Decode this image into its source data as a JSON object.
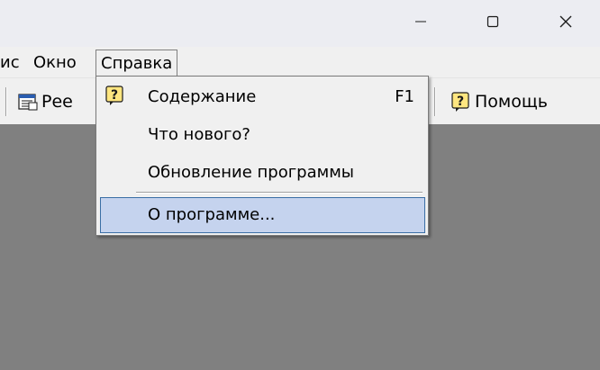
{
  "window": {
    "buttons": {
      "minimize_icon": "minimize-icon",
      "maximize_icon": "maximize-icon",
      "close_icon": "close-icon"
    }
  },
  "menubar": {
    "items": [
      {
        "label": "ис",
        "open": false
      },
      {
        "label": "Окно",
        "open": false
      },
      {
        "label": "Справка",
        "open": true
      }
    ]
  },
  "toolbar": {
    "registry_label": "Рее",
    "help_label": "Помощь"
  },
  "help_menu": {
    "items": [
      {
        "label": "Содержание",
        "shortcut": "F1"
      },
      {
        "label": "Что нового?",
        "shortcut": ""
      },
      {
        "label": "Обновление программы",
        "shortcut": ""
      },
      {
        "label": "О программе...",
        "shortcut": ""
      }
    ],
    "selected_index": 3
  },
  "colors": {
    "workspace": "#808080",
    "selection_fill": "#c5d3ee",
    "selection_border": "#3a6ea5",
    "help_icon_fill": "#ffe680"
  }
}
